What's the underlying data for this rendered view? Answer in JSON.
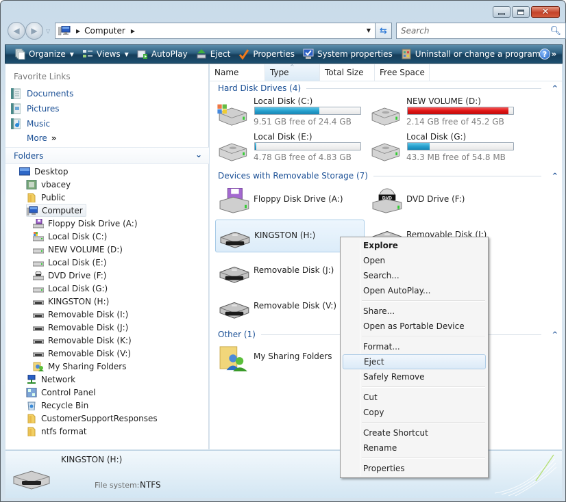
{
  "window": {
    "controls": {
      "minimize": "minimize",
      "maximize": "maximize",
      "close": "close"
    }
  },
  "address": {
    "crumbs": [
      "Computer"
    ],
    "search_placeholder": "Search"
  },
  "toolbar": {
    "items": [
      {
        "label": "Organize",
        "icon": "organize-icon",
        "dropdown": true
      },
      {
        "label": "Views",
        "icon": "views-icon",
        "dropdown": true
      },
      {
        "label": "AutoPlay",
        "icon": "autoplay-icon"
      },
      {
        "label": "Eject",
        "icon": "eject-icon"
      },
      {
        "label": "Properties",
        "icon": "properties-check-icon"
      },
      {
        "label": "System properties",
        "icon": "system-properties-icon"
      },
      {
        "label": "Uninstall or change a program",
        "icon": "uninstall-icon"
      }
    ],
    "overflow": "»",
    "help": "?"
  },
  "nav": {
    "favorites_title": "Favorite Links",
    "favorites": [
      {
        "label": "Documents",
        "icon": "documents-icon"
      },
      {
        "label": "Pictures",
        "icon": "pictures-icon"
      },
      {
        "label": "Music",
        "icon": "music-icon"
      }
    ],
    "more": "More",
    "more_glyph": "»",
    "folders_title": "Folders",
    "tree": [
      {
        "label": "Desktop",
        "level": 0,
        "icon": "desktop-icon"
      },
      {
        "label": "vbacey",
        "level": 1,
        "icon": "user-folder-icon"
      },
      {
        "label": "Public",
        "level": 1,
        "icon": "folder-icon"
      },
      {
        "label": "Computer",
        "level": 1,
        "icon": "computer-icon",
        "selected": true
      },
      {
        "label": "Floppy Disk Drive (A:)",
        "level": 2,
        "icon": "floppy-drive-icon"
      },
      {
        "label": "Local Disk (C:)",
        "level": 2,
        "icon": "system-drive-icon"
      },
      {
        "label": "NEW VOLUME (D:)",
        "level": 2,
        "icon": "hard-drive-icon"
      },
      {
        "label": "Local Disk (E:)",
        "level": 2,
        "icon": "hard-drive-icon"
      },
      {
        "label": "DVD Drive (F:)",
        "level": 2,
        "icon": "dvd-drive-icon"
      },
      {
        "label": "Local Disk (G:)",
        "level": 2,
        "icon": "hard-drive-icon"
      },
      {
        "label": "KINGSTON (H:)",
        "level": 2,
        "icon": "removable-drive-icon"
      },
      {
        "label": "Removable Disk (I:)",
        "level": 2,
        "icon": "removable-drive-icon"
      },
      {
        "label": "Removable Disk (J:)",
        "level": 2,
        "icon": "removable-drive-icon"
      },
      {
        "label": "Removable Disk (K:)",
        "level": 2,
        "icon": "removable-drive-icon"
      },
      {
        "label": "Removable Disk (V:)",
        "level": 2,
        "icon": "removable-drive-icon"
      },
      {
        "label": "My Sharing Folders",
        "level": 2,
        "icon": "sharing-folders-icon"
      },
      {
        "label": "Network",
        "level": 1,
        "icon": "network-icon"
      },
      {
        "label": "Control Panel",
        "level": 1,
        "icon": "control-panel-icon"
      },
      {
        "label": "Recycle Bin",
        "level": 1,
        "icon": "recycle-bin-icon"
      },
      {
        "label": "CustomerSupportResponses",
        "level": 1,
        "icon": "folder-icon"
      },
      {
        "label": "ntfs format",
        "level": 1,
        "icon": "folder-icon"
      }
    ]
  },
  "columns": [
    {
      "label": "Name"
    },
    {
      "label": "Type",
      "sorted": true
    },
    {
      "label": "Total Size"
    },
    {
      "label": "Free Space"
    }
  ],
  "groups": {
    "hdd": {
      "title": "Hard Disk Drives (4)",
      "drives": [
        {
          "name": "Local Disk (C:)",
          "free": "9.51 GB free of 24.4 GB",
          "used_fraction": 0.61,
          "critical": false,
          "icon": "system-drive-icon"
        },
        {
          "name": "NEW VOLUME (D:)",
          "free": "2.14 GB free of 45.2 GB",
          "used_fraction": 0.953,
          "critical": true,
          "icon": "hard-drive-icon"
        },
        {
          "name": "Local Disk (E:)",
          "free": "4.78 GB free of 4.83 GB",
          "used_fraction": 0.01,
          "critical": false,
          "icon": "hard-drive-icon"
        },
        {
          "name": "Local Disk (G:)",
          "free": "43.3 MB free of 54.8 MB",
          "used_fraction": 0.21,
          "critical": false,
          "icon": "hard-drive-icon"
        }
      ]
    },
    "removable": {
      "title": "Devices with Removable Storage (7)",
      "devices": [
        {
          "name": "Floppy Disk Drive (A:)",
          "icon": "floppy-drive-icon"
        },
        {
          "name": "DVD Drive (F:)",
          "icon": "dvd-drive-icon"
        },
        {
          "name": "KINGSTON (H:)",
          "icon": "removable-drive-icon",
          "selected": true
        },
        {
          "name": "Removable Disk (I:)",
          "icon": "removable-drive-icon"
        },
        {
          "name": "Removable Disk (J:)",
          "icon": "removable-drive-icon"
        },
        {
          "name": "Removable Disk (V:)",
          "icon": "removable-drive-icon"
        }
      ]
    },
    "other": {
      "title": "Other (1)",
      "items": [
        {
          "name": "My Sharing Folders",
          "icon": "sharing-folders-icon"
        }
      ]
    }
  },
  "context_menu": {
    "items": [
      {
        "label": "Explore",
        "bold": true
      },
      {
        "label": "Open"
      },
      {
        "label": "Search..."
      },
      {
        "label": "Open AutoPlay..."
      },
      {
        "sep": true
      },
      {
        "label": "Share..."
      },
      {
        "label": "Open as Portable Device"
      },
      {
        "sep": true
      },
      {
        "label": "Format..."
      },
      {
        "label": "Eject",
        "hover": true
      },
      {
        "label": "Safely Remove"
      },
      {
        "sep": true
      },
      {
        "label": "Cut"
      },
      {
        "label": "Copy"
      },
      {
        "sep": true
      },
      {
        "label": "Create Shortcut"
      },
      {
        "label": "Rename"
      },
      {
        "sep": true
      },
      {
        "label": "Properties"
      }
    ]
  },
  "details": {
    "name": "KINGSTON (H:)",
    "fs_label": "File system:",
    "fs_value": "NTFS"
  },
  "colors": {
    "link": "#1a4f95",
    "bar_normal": "#27a1cf",
    "bar_critical": "#e01515",
    "toolbar": "#2c5e7f"
  }
}
